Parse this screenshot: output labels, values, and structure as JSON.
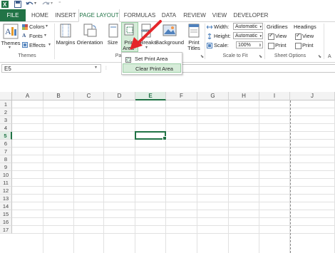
{
  "quick_access": {
    "icons": [
      "excel-logo-icon",
      "save-icon",
      "undo-icon",
      "redo-icon"
    ]
  },
  "tabs": [
    {
      "label": "FILE",
      "active": false,
      "file": true
    },
    {
      "label": "HOME",
      "active": false
    },
    {
      "label": "INSERT",
      "active": false
    },
    {
      "label": "PAGE LAYOUT",
      "active": true
    },
    {
      "label": "FORMULAS",
      "active": false
    },
    {
      "label": "DATA",
      "active": false
    },
    {
      "label": "REVIEW",
      "active": false
    },
    {
      "label": "VIEW",
      "active": false
    },
    {
      "label": "DEVELOPER",
      "active": false
    }
  ],
  "ribbon": {
    "themes": {
      "button": "Themes",
      "colors": "Colors",
      "fonts": "Fonts",
      "effects": "Effects",
      "group_label": "Themes"
    },
    "page_setup": {
      "margins": "Margins",
      "orientation": "Orientation",
      "size": "Size",
      "print_area_line1": "Print",
      "print_area_line2": "Area",
      "breaks": "Breaks",
      "background": "Background",
      "print_titles_line1": "Print",
      "print_titles_line2": "Titles",
      "group_label": "Page Setup"
    },
    "scale_to_fit": {
      "width_label": "Width:",
      "width_value": "Automatic",
      "height_label": "Height:",
      "height_value": "Automatic",
      "scale_label": "Scale:",
      "scale_value": "100%",
      "group_label": "Scale to Fit"
    },
    "sheet_options": {
      "gridlines": "Gridlines",
      "headings": "Headings",
      "view": "View",
      "print": "Print",
      "gridlines_view": true,
      "gridlines_print": false,
      "headings_view": true,
      "headings_print": false,
      "group_label": "Sheet Options"
    }
  },
  "print_area_menu": {
    "items": [
      "Set Print Area",
      "Clear Print Area"
    ],
    "highlighted": "Clear Print Area"
  },
  "formula_bar": {
    "name_box": "E5",
    "formula": ""
  },
  "grid": {
    "columns": [
      "A",
      "B",
      "C",
      "D",
      "E",
      "F",
      "G",
      "H",
      "I",
      "J"
    ],
    "rows": [
      "1",
      "2",
      "3",
      "4",
      "5",
      "6",
      "7",
      "8",
      "9",
      "10",
      "11",
      "12",
      "13",
      "14",
      "15",
      "16",
      "17"
    ],
    "active_cell": "E5"
  },
  "colors": {
    "accent": "#217346",
    "arrow": "#e5262a"
  }
}
